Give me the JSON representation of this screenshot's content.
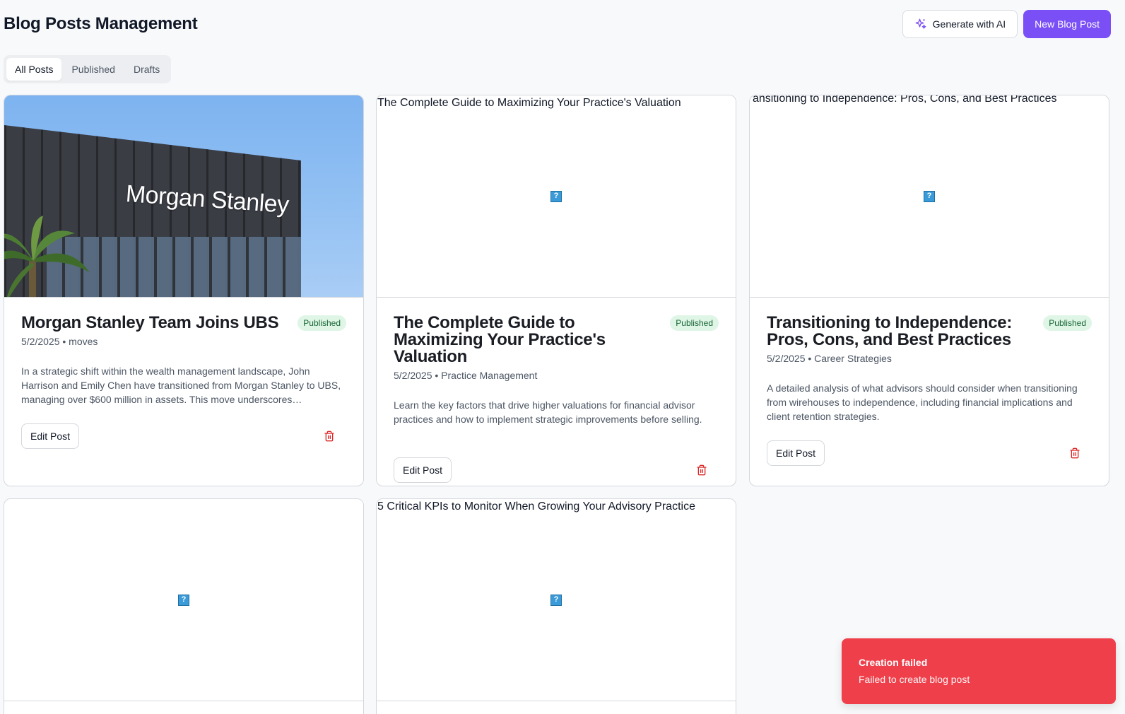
{
  "page_title": "Blog Posts Management",
  "actions": {
    "generate_ai_label": "Generate with AI",
    "new_post_label": "New Blog Post"
  },
  "tabs": [
    {
      "label": "All Posts",
      "active": true
    },
    {
      "label": "Published",
      "active": false
    },
    {
      "label": "Drafts",
      "active": false
    }
  ],
  "colors": {
    "primary": "#7b4ff6",
    "published_badge_bg": "#dff5e6",
    "published_badge_text": "#166534",
    "delete_icon": "#dc2626",
    "toast_bg": "#ef3f4a"
  },
  "posts": [
    {
      "image_kind": "photo",
      "image_logo_text": "Morgan Stanley",
      "image_alt": "",
      "title": "Morgan Stanley Team Joins UBS",
      "status": "Published",
      "meta": "5/2/2025 • moves",
      "excerpt": "In a strategic shift within the wealth management landscape, John Harrison and Emily Chen have transitioned from Morgan Stanley to UBS, managing over $600 million in assets. This move underscores…",
      "edit_label": "Edit Post"
    },
    {
      "image_kind": "broken",
      "image_alt": "The Complete Guide to Maximizing Your Practice's Valuation",
      "title": "The Complete Guide to Maximizing Your Practice's Valuation",
      "status": "Published",
      "meta": "5/2/2025 • Practice Management",
      "excerpt": "Learn the key factors that drive higher valuations for financial advisor practices and how to implement strategic improvements before selling.",
      "edit_label": "Edit Post"
    },
    {
      "image_kind": "broken",
      "image_alt": "ansitioning to Independence: Pros, Cons, and Best Practices",
      "title": "Transitioning to Independence: Pros, Cons, and Best Practices",
      "status": "Published",
      "meta": "5/2/2025 • Career Strategies",
      "excerpt": "A detailed analysis of what advisors should consider when transitioning from wirehouses to independence, including financial implications and client retention strategies.",
      "edit_label": "Edit Post"
    },
    {
      "image_kind": "broken",
      "image_alt": ""
    },
    {
      "image_kind": "broken",
      "image_alt": "5 Critical KPIs to Monitor When Growing Your Advisory Practice"
    }
  ],
  "toast": {
    "title": "Creation failed",
    "message": "Failed to create blog post"
  }
}
